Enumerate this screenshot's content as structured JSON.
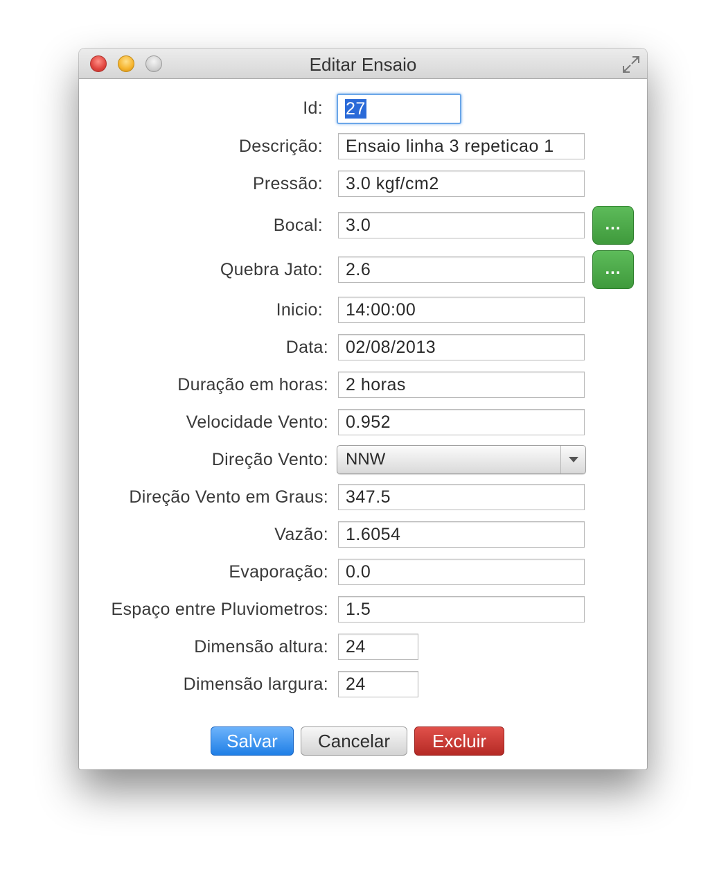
{
  "window": {
    "title": "Editar Ensaio"
  },
  "fields": {
    "id": {
      "label": "Id:",
      "value": "27"
    },
    "descricao": {
      "label": "Descrição:",
      "value": "Ensaio linha 3 repeticao 1"
    },
    "pressao": {
      "label": "Pressão:",
      "value": "3.0 kgf/cm2"
    },
    "bocal": {
      "label": "Bocal:",
      "value": "3.0",
      "button": "..."
    },
    "quebra_jato": {
      "label": "Quebra Jato:",
      "value": "2.6",
      "button": "..."
    },
    "inicio": {
      "label": "Inicio:",
      "value": "14:00:00"
    },
    "data": {
      "label": "Data:",
      "value": "02/08/2013"
    },
    "duracao": {
      "label": "Duração em horas:",
      "value": "2 horas"
    },
    "velocidade_vento": {
      "label": "Velocidade Vento:",
      "value": "0.952"
    },
    "direcao_vento": {
      "label": "Direção Vento:",
      "selected": "NNW"
    },
    "direcao_vento_graus": {
      "label": "Direção Vento em Graus:",
      "value": "347.5"
    },
    "vazao": {
      "label": "Vazão:",
      "value": "1.6054"
    },
    "evaporacao": {
      "label": "Evaporação:",
      "value": "0.0"
    },
    "espaco_pluviometros": {
      "label": "Espaço entre Pluviometros:",
      "value": "1.5"
    },
    "dimensao_altura": {
      "label": "Dimensão altura:",
      "value": "24"
    },
    "dimensao_largura": {
      "label": "Dimensão largura:",
      "value": "24"
    }
  },
  "buttons": {
    "save": "Salvar",
    "cancel": "Cancelar",
    "delete": "Excluir"
  },
  "colors": {
    "save_button": "#1f7fe6",
    "delete_button": "#b52a25",
    "picker_button": "#4aa847",
    "focus_ring": "#6aa6e8",
    "selection": "#2a6ad8"
  },
  "icons": {
    "close": "close-icon",
    "minimize": "minimize-icon",
    "zoom": "zoom-icon",
    "fullscreen": "fullscreen-icon",
    "dropdown": "chevron-down-icon"
  }
}
